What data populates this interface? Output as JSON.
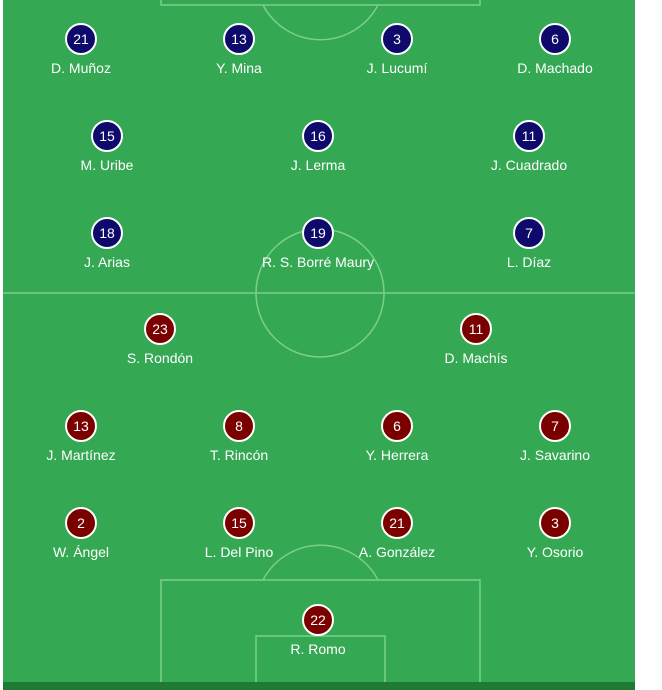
{
  "colors": {
    "pitch": "#34a853",
    "lines": "#7ccf8a",
    "home_badge": "#0d0a6b",
    "away_badge": "#7a0000",
    "text": "#ffffff"
  },
  "home_team": {
    "players": [
      {
        "number": "21",
        "name": "D. Muñoz"
      },
      {
        "number": "13",
        "name": "Y. Mina"
      },
      {
        "number": "3",
        "name": "J. Lucumí"
      },
      {
        "number": "6",
        "name": "D. Machado"
      },
      {
        "number": "15",
        "name": "M. Uribe"
      },
      {
        "number": "16",
        "name": "J. Lerma"
      },
      {
        "number": "11",
        "name": "J. Cuadrado"
      },
      {
        "number": "18",
        "name": "J. Arias"
      },
      {
        "number": "19",
        "name": "R. S. Borré Maury"
      },
      {
        "number": "7",
        "name": "L. Díaz"
      }
    ]
  },
  "away_team": {
    "players": [
      {
        "number": "23",
        "name": "S. Rondón"
      },
      {
        "number": "11",
        "name": "D. Machís"
      },
      {
        "number": "13",
        "name": "J. Martínez"
      },
      {
        "number": "8",
        "name": "T. Rincón"
      },
      {
        "number": "6",
        "name": "Y. Herrera"
      },
      {
        "number": "7",
        "name": "J. Savarino"
      },
      {
        "number": "2",
        "name": "W. Ángel"
      },
      {
        "number": "15",
        "name": "L. Del Pino"
      },
      {
        "number": "21",
        "name": "A. González"
      },
      {
        "number": "3",
        "name": "Y. Osorio"
      },
      {
        "number": "22",
        "name": "R. Romo"
      }
    ]
  }
}
